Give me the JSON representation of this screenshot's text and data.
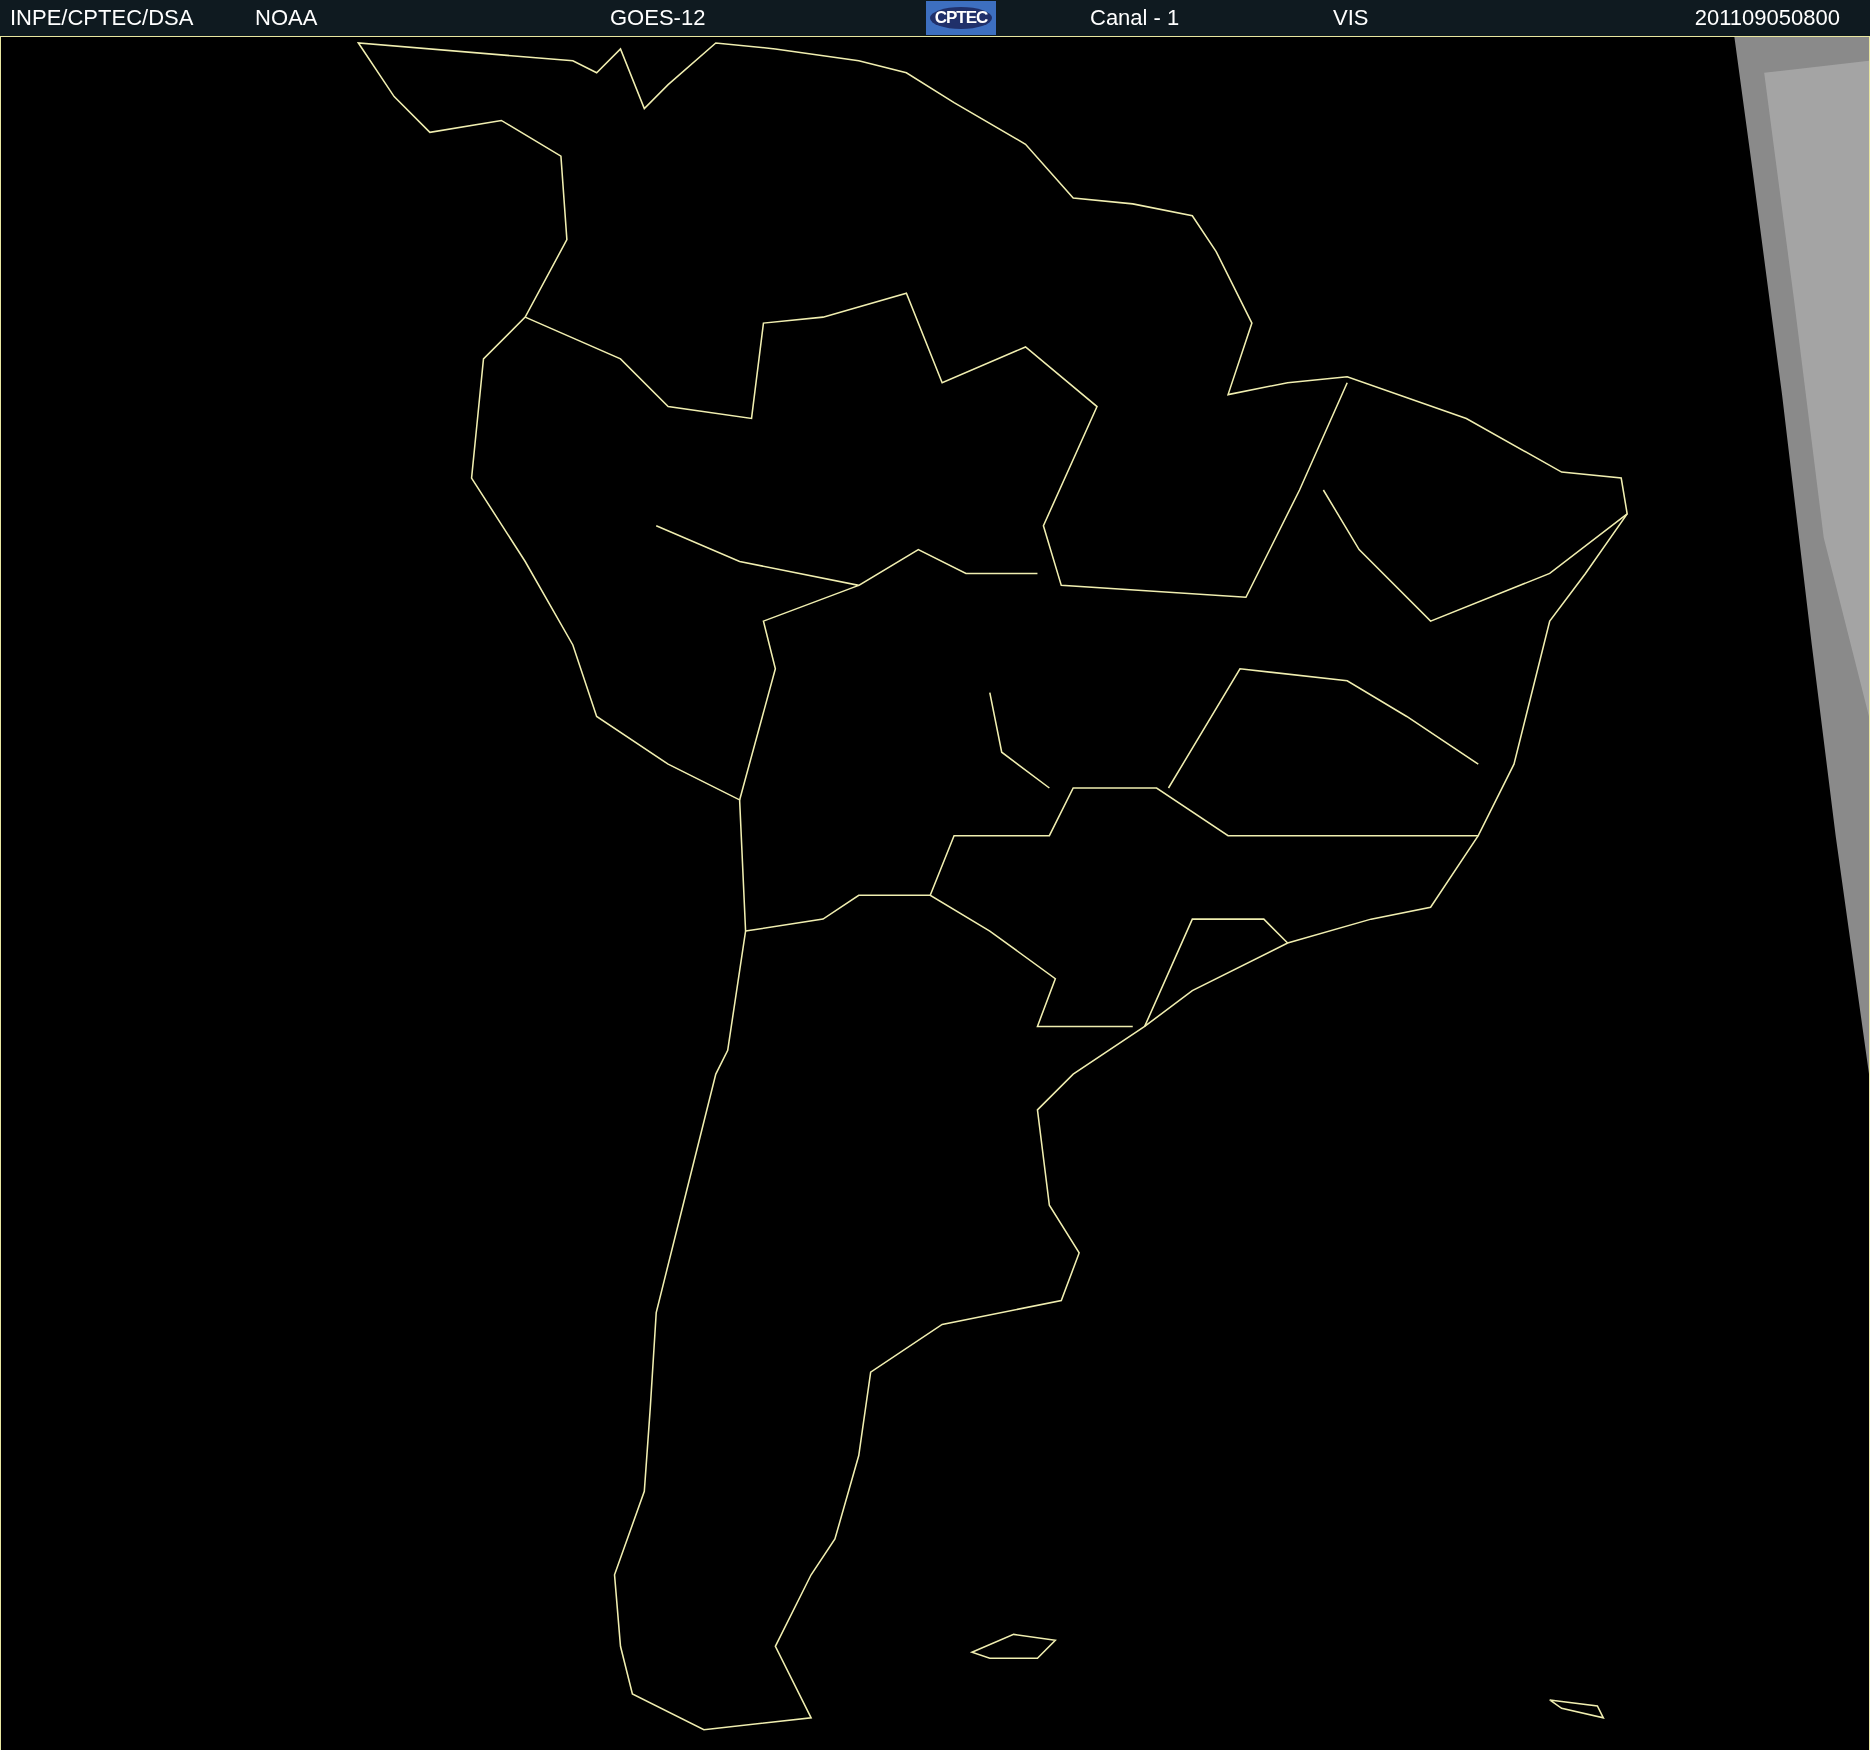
{
  "header": {
    "source": "INPE/CPTEC/DSA",
    "agency": "NOAA",
    "satellite": "GOES-12",
    "logo": "CPTEC",
    "channel": "Canal - 1",
    "band": "VIS",
    "timestamp": "201109050800"
  }
}
